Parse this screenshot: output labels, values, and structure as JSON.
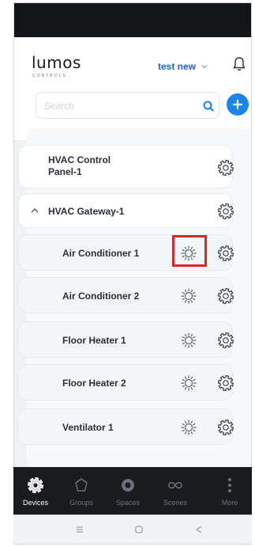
{
  "header": {
    "logo_text": "lumos",
    "logo_subtext": "CONTROLS",
    "user_name": "test new"
  },
  "search": {
    "placeholder": "Search"
  },
  "devices": [
    {
      "label": "HVAC Control Panel-1",
      "line1": "HVAC Control",
      "line2": "Panel-1",
      "has_settings": true,
      "has_control": false
    },
    {
      "label": "HVAC Gateway-1",
      "expanded": true,
      "has_settings": true,
      "has_control": false
    },
    {
      "label": "Air Conditioner 1",
      "has_settings": true,
      "has_control": true,
      "highlighted": true
    },
    {
      "label": "Air Conditioner 2",
      "has_settings": true,
      "has_control": true
    },
    {
      "label": "Floor Heater 1",
      "has_settings": true,
      "has_control": true
    },
    {
      "label": "Floor Heater 2",
      "has_settings": true,
      "has_control": true
    },
    {
      "label": "Ventilator 1",
      "has_settings": true,
      "has_control": true
    }
  ],
  "tabs": [
    {
      "label": "Devices",
      "icon": "devices-icon",
      "active": true
    },
    {
      "label": "Groups",
      "icon": "groups-icon",
      "active": false
    },
    {
      "label": "Spaces",
      "icon": "spaces-icon",
      "active": false
    },
    {
      "label": "Scenes",
      "icon": "scenes-icon",
      "active": false
    },
    {
      "label": "More",
      "icon": "more-icon",
      "active": false
    }
  ],
  "colors": {
    "accent": "#1a84e8",
    "user_name": "#1d63d6",
    "highlight": "#d62828",
    "tab_bar": "#1a1b1f"
  }
}
